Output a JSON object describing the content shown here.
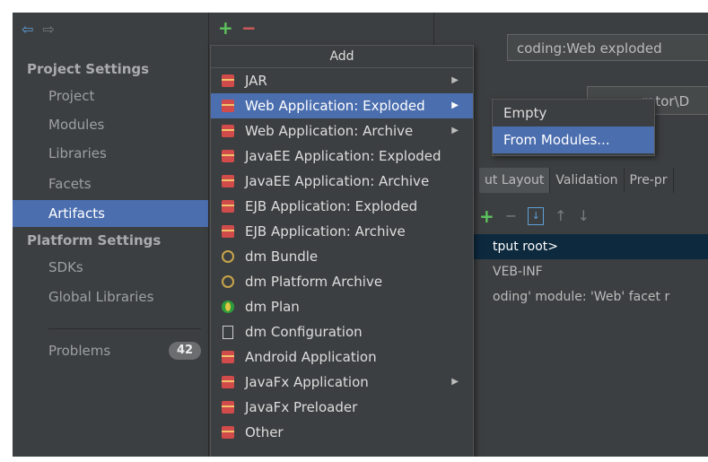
{
  "sidebar": {
    "sections": [
      {
        "title": "Project Settings",
        "items": [
          "Project",
          "Modules",
          "Libraries",
          "Facets",
          "Artifacts"
        ]
      },
      {
        "title": "Platform Settings",
        "items": [
          "SDKs",
          "Global Libraries"
        ]
      }
    ],
    "selected": "Artifacts",
    "problems": {
      "label": "Problems",
      "count": "42"
    }
  },
  "toolbar": {
    "add_label": "+",
    "remove_label": "−"
  },
  "detail": {
    "name_value": "coding:Web exploded",
    "output_dir_value": "rator\\D",
    "tabs": [
      "ut Layout",
      "Validation",
      "Pre-pr"
    ],
    "active_tab": "ut Layout",
    "tree": [
      {
        "label": "tput root>",
        "selected": true
      },
      {
        "label": "VEB-INF",
        "selected": false
      },
      {
        "label": "oding' module: 'Web' facet r",
        "selected": false
      }
    ]
  },
  "add_menu": {
    "title": "Add",
    "items": [
      {
        "label": "JAR",
        "icon": "jar-icon",
        "submenu": true,
        "selected": false
      },
      {
        "label": "Web Application: Exploded",
        "icon": "web-app-icon",
        "submenu": true,
        "selected": true
      },
      {
        "label": "Web Application: Archive",
        "icon": "web-app-icon",
        "submenu": true,
        "selected": false
      },
      {
        "label": "JavaEE Application: Exploded",
        "icon": "javaee-icon",
        "submenu": false,
        "selected": false
      },
      {
        "label": "JavaEE Application: Archive",
        "icon": "javaee-icon",
        "submenu": false,
        "selected": false
      },
      {
        "label": "EJB Application: Exploded",
        "icon": "ejb-icon",
        "submenu": false,
        "selected": false
      },
      {
        "label": "EJB Application: Archive",
        "icon": "ejb-icon",
        "submenu": false,
        "selected": false
      },
      {
        "label": "dm Bundle",
        "icon": "bundle-icon",
        "submenu": false,
        "selected": false
      },
      {
        "label": "dm Platform Archive",
        "icon": "bundle-icon",
        "submenu": false,
        "selected": false
      },
      {
        "label": "dm Plan",
        "icon": "plan-icon",
        "submenu": false,
        "selected": false
      },
      {
        "label": "dm Configuration",
        "icon": "document-icon",
        "submenu": false,
        "selected": false
      },
      {
        "label": "Android Application",
        "icon": "jar-icon",
        "submenu": false,
        "selected": false
      },
      {
        "label": "JavaFx Application",
        "icon": "jar-icon",
        "submenu": true,
        "selected": false
      },
      {
        "label": "JavaFx Preloader",
        "icon": "jar-icon",
        "submenu": false,
        "selected": false
      },
      {
        "label": "Other",
        "icon": "jar-icon",
        "submenu": false,
        "selected": false
      }
    ]
  },
  "sub_menu": {
    "items": [
      {
        "label": "Empty",
        "selected": false
      },
      {
        "label": "From Modules...",
        "selected": true
      }
    ]
  },
  "colors": {
    "background": "#3c3f41",
    "selection": "#4b6eaf",
    "add_green": "#5dc45d",
    "remove_red": "#d35b5b"
  }
}
